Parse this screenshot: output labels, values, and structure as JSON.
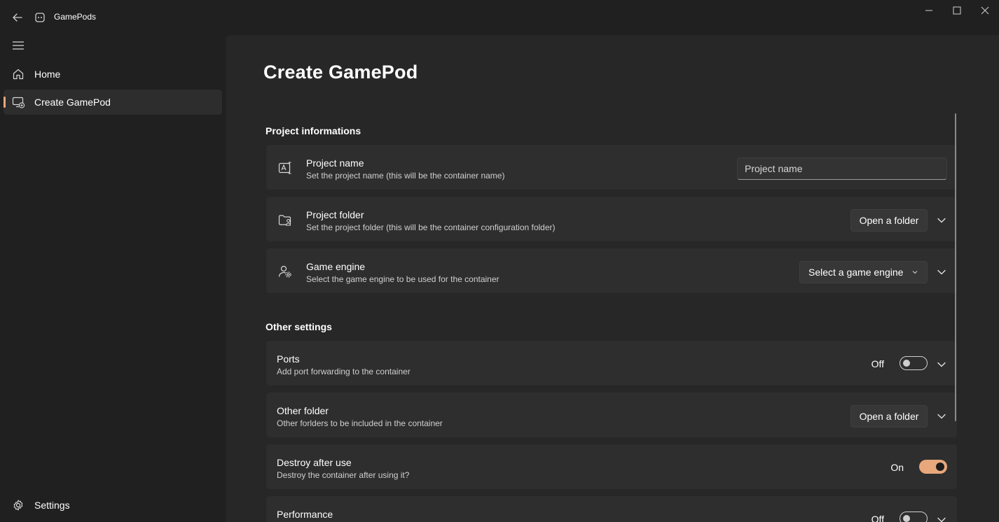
{
  "window": {
    "app_title": "GamePods",
    "controls": [
      "minimize-icon",
      "maximize-icon",
      "close-icon"
    ]
  },
  "sidebar": {
    "menu_icon": "hamburger-icon",
    "items": [
      {
        "label": "Home",
        "icon": "home-icon",
        "selected": false
      },
      {
        "label": "Create GamePod",
        "icon": "create-gamepod-icon",
        "selected": true
      }
    ],
    "footer": {
      "label": "Settings",
      "icon": "gear-icon"
    }
  },
  "page": {
    "title": "Create GamePod",
    "sections": {
      "project": {
        "title": "Project informations",
        "name": {
          "title": "Project name",
          "description": "Set the project name (this will be the container name)",
          "placeholder": "Project name",
          "icon": "rename-icon"
        },
        "folder": {
          "title": "Project folder",
          "description": "Set the project folder (this will be the container configuration folder)",
          "button": "Open a folder",
          "icon": "folder-person-icon"
        },
        "engine": {
          "title": "Game engine",
          "description": "Select the game engine to be used for the container",
          "dropdown": "Select a game engine",
          "icon": "person-gear-icon"
        }
      },
      "other": {
        "title": "Other settings",
        "ports": {
          "title": "Ports",
          "description": "Add port forwarding to the container",
          "toggle_label": "Off",
          "toggle_on": false
        },
        "other_folder": {
          "title": "Other folder",
          "description": "Other forlders to be included in the container",
          "button": "Open a folder"
        },
        "destroy": {
          "title": "Destroy after use",
          "description": "Destroy the container after using it?",
          "toggle_label": "On",
          "toggle_on": true
        },
        "performance": {
          "title": "Performance",
          "toggle_label": "Off",
          "toggle_on": false
        }
      }
    }
  },
  "colors": {
    "accent": "#e8a87c",
    "window_bg": "#202020",
    "content_bg": "#272727",
    "card_bg": "#2e2e2e"
  }
}
